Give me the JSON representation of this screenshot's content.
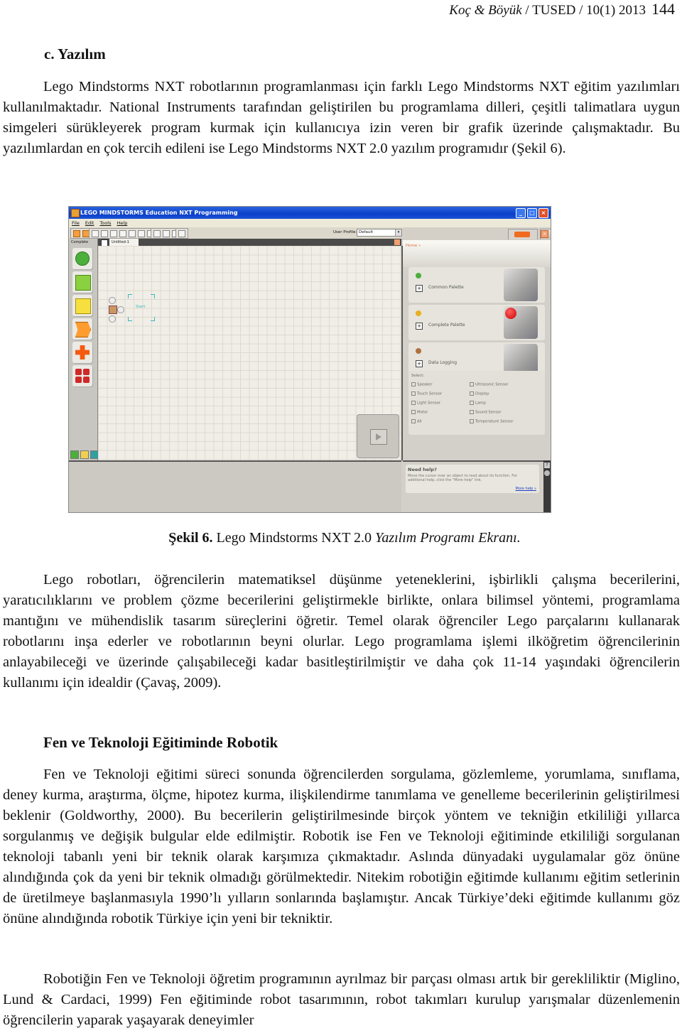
{
  "running_head": {
    "authors": "Koç & Böyük",
    "journal": " / TUSED / 10(1) 2013",
    "page_number": "144"
  },
  "section_heading": "c. Yazılım",
  "paragraphs": {
    "p1": "Lego Mindstorms NXT robotlarının programlanması için farklı Lego Mindstorms NXT eğitim yazılımları kullanılmaktadır. National Instruments tarafından geliştirilen bu programlama dilleri, çeşitli talimatlara uygun simgeleri sürükleyerek program kurmak için kullanıcıya izin veren bir grafik üzerinde çalışmaktadır. Bu yazılımlardan en çok tercih edileni ise Lego Mindstorms NXT 2.0 yazılım programıdır (Şekil 6).",
    "p2": "Lego robotları, öğrencilerin matematiksel düşünme yeteneklerini, işbirlikli çalışma becerilerini, yaratıcılıklarını ve problem çözme becerilerini geliştirmekle birlikte, onlara bilimsel yöntemi, programlama mantığını ve mühendislik tasarım süreçlerini öğretir. Temel olarak öğrenciler Lego parçalarını kullanarak robotlarını inşa ederler ve robotlarının beyni olurlar. Lego programlama işlemi ilköğretim öğrencilerinin anlayabileceği ve üzerinde çalışabileceği kadar basitleştirilmiştir ve daha çok 11-14 yaşındaki öğrencilerin kullanımı için idealdir (Çavaş, 2009).",
    "p3": "Fen ve Teknoloji eğitimi süreci sonunda öğrencilerden sorgulama, gözlemleme, yorumlama, sınıflama, deney kurma, araştırma, ölçme, hipotez kurma, ilişkilendirme tanımlama ve genelleme becerilerinin geliştirilmesi beklenir (Goldworthy, 2000). Bu becerilerin geliştirilmesinde birçok yöntem ve tekniğin etkililiği yıllarca sorgulanmış ve değişik bulgular elde edilmiştir. Robotik ise Fen ve Teknoloji eğitiminde etkililiği sorgulanan teknoloji tabanlı yeni bir teknik olarak karşımıza çıkmaktadır. Aslında dünyadaki uygulamalar göz önüne alındığında çok da yeni bir teknik olmadığı görülmektedir. Nitekim robotiğin eğitimde kullanımı eğitim setlerinin de üretilmeye başlanmasıyla 1990’lı yılların sonlarında başlamıştır. Ancak Türkiye’deki eğitimde kullanımı göz önüne alındığında robotik Türkiye için yeni bir tekniktir.",
    "p4": "Robotiğin Fen ve Teknoloji öğretim programının ayrılmaz bir parçası olması artık bir gerekliliktir (Miglino, Lund & Cardaci, 1999) Fen eğitiminde robot tasarımının, robot takımları kurulup yarışmalar düzenlemenin öğrencilerin yaparak yaşayarak deneyimler"
  },
  "sub_heading": "Fen ve Teknoloji Eğitiminde Robotik",
  "caption": {
    "label": "Şekil 6.",
    "text": " Lego Mindstorms NXT 2.0 ",
    "italic": "Yazılım Programı Ekranı."
  },
  "figure": {
    "window_title": "LEGO MINDSTORMS Education NXT Programming",
    "window_buttons": [
      "_",
      "□",
      "×"
    ],
    "menu": [
      "File",
      "Edit",
      "Tools",
      "Help"
    ],
    "user_profile_label": "User Profile:",
    "user_profile_value": "Default",
    "palette_label": "Complete",
    "palette_blocks": [
      "common-blocks",
      "action-blocks",
      "sensor-blocks",
      "flow-blocks",
      "data-blocks",
      "advanced-blocks"
    ],
    "document_tab": "Untitled-1",
    "start_label": "Start",
    "home_link": "Home »",
    "palettes": [
      {
        "name": "Common Palette",
        "color": "#4caf3c"
      },
      {
        "name": "Complete Palette",
        "color": "#e8b020"
      },
      {
        "name": "Data Logging",
        "color": "#b07040"
      }
    ],
    "select_title": "Select:",
    "sensors_left": [
      "Speaker",
      "Touch Sensor",
      "Light Sensor",
      "Motor",
      "All"
    ],
    "sensors_right": [
      "Ultrasonic Sensor",
      "Display",
      "Lamp",
      "Sound Sensor",
      "Temperature Sensor"
    ],
    "help": {
      "title": "Need help?",
      "text": "Move the cursor over an object to read about its function. For additional help, click the \"More help\" link.",
      "more_link": "More help »",
      "question_mark": "?"
    }
  }
}
